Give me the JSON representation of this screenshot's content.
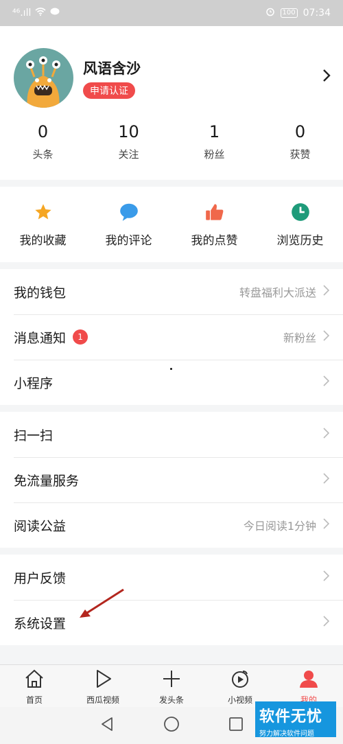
{
  "status_bar": {
    "signal": "⁴⁶.ıll",
    "battery": "100",
    "time": "07:34"
  },
  "profile": {
    "name": "风语含沙",
    "cert_badge": "申请认证"
  },
  "stats": [
    {
      "value": "0",
      "label": "头条"
    },
    {
      "value": "10",
      "label": "关注"
    },
    {
      "value": "1",
      "label": "粉丝"
    },
    {
      "value": "0",
      "label": "获赞"
    }
  ],
  "quick_actions": [
    {
      "label": "我的收藏",
      "icon": "star-icon",
      "color": "#f5a623"
    },
    {
      "label": "我的评论",
      "icon": "comment-icon",
      "color": "#3a9be9"
    },
    {
      "label": "我的点赞",
      "icon": "thumbs-up-icon",
      "color": "#f0684b"
    },
    {
      "label": "浏览历史",
      "icon": "clock-icon",
      "color": "#1e9b7a"
    }
  ],
  "menu_group_1": [
    {
      "title": "我的钱包",
      "sub": "转盘福利大派送"
    },
    {
      "title": "消息通知",
      "badge": "1",
      "sub": "新粉丝"
    },
    {
      "title": "小程序",
      "sub": ""
    }
  ],
  "menu_group_2": [
    {
      "title": "扫一扫",
      "sub": ""
    },
    {
      "title": "免流量服务",
      "sub": ""
    },
    {
      "title": "阅读公益",
      "sub": "今日阅读1分钟"
    }
  ],
  "menu_group_3": [
    {
      "title": "用户反馈",
      "sub": ""
    },
    {
      "title": "系统设置",
      "sub": ""
    }
  ],
  "tabs": [
    {
      "label": "首页",
      "icon": "home-icon"
    },
    {
      "label": "西瓜视频",
      "icon": "play-icon"
    },
    {
      "label": "发头条",
      "icon": "plus-icon"
    },
    {
      "label": "小视频",
      "icon": "short-video-icon"
    },
    {
      "label": "我的",
      "icon": "person-icon",
      "active": true
    }
  ],
  "watermark": {
    "title": "软件无忧",
    "sub": "努力解决软件问题"
  },
  "colors": {
    "accent": "#f04b4b",
    "background": "#f4f5f6"
  }
}
